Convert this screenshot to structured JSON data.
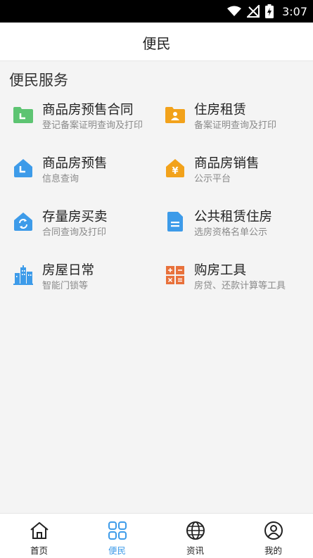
{
  "status_bar": {
    "time": "3:07"
  },
  "header": {
    "title": "便民"
  },
  "section": {
    "title": "便民服务"
  },
  "services": [
    {
      "title": "商品房预售合同",
      "subtitle": "登记备案证明查询及打印",
      "icon": "folder-icon",
      "color": "#5dc472"
    },
    {
      "title": "住房租赁",
      "subtitle": "备案证明查询及打印",
      "icon": "folder-person-icon",
      "color": "#f2a21b"
    },
    {
      "title": "商品房预售",
      "subtitle": "信息查询",
      "icon": "house-icon",
      "color": "#3d9be9"
    },
    {
      "title": "商品房销售",
      "subtitle": "公示平台",
      "icon": "house-yen-icon",
      "color": "#f2a21b"
    },
    {
      "title": "存量房买卖",
      "subtitle": "合同查询及打印",
      "icon": "house-refresh-icon",
      "color": "#3d9be9"
    },
    {
      "title": "公共租赁住房",
      "subtitle": "选房资格名单公示",
      "icon": "document-icon",
      "color": "#3d9be9"
    },
    {
      "title": "房屋日常",
      "subtitle": "智能门锁等",
      "icon": "buildings-icon",
      "color": "#3d9be9"
    },
    {
      "title": "购房工具",
      "subtitle": "房贷、还款计算等工具",
      "icon": "calculator-icon",
      "color": "#e8713b"
    }
  ],
  "tabs": [
    {
      "label": "首页",
      "icon": "home-icon"
    },
    {
      "label": "便民",
      "icon": "grid-icon",
      "active": true
    },
    {
      "label": "资讯",
      "icon": "globe-icon"
    },
    {
      "label": "我的",
      "icon": "user-icon"
    }
  ]
}
